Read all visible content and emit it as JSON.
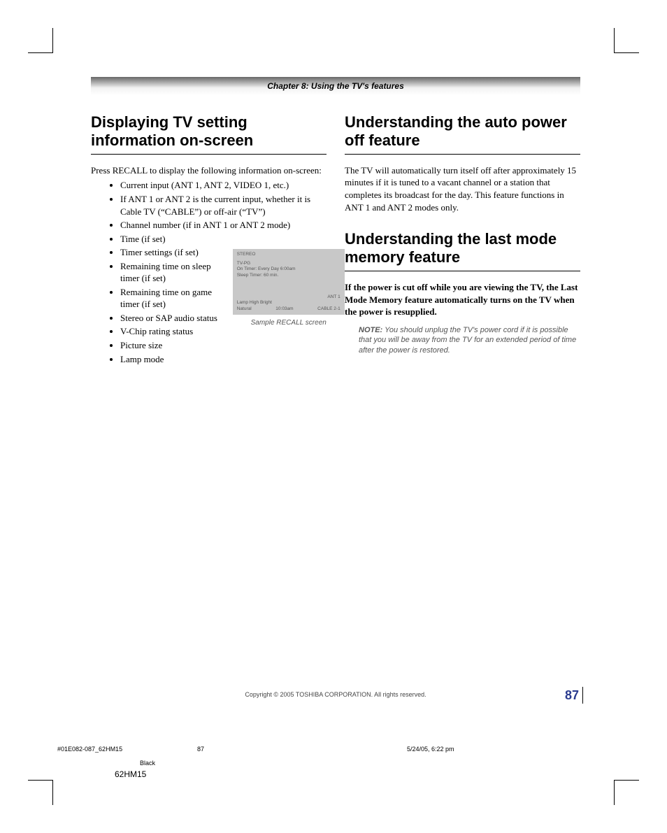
{
  "chapter": "Chapter 8: Using the TV's features",
  "left": {
    "title": "Displaying TV setting information on-screen",
    "intro": "Press RECALL to display the following information on-screen:",
    "items": [
      "Current input (ANT 1, ANT 2, VIDEO 1, etc.)",
      "If ANT 1 or ANT 2 is the current input, whether it is Cable TV (“CABLE”) or off-air (“TV”)",
      "Channel number (if in ANT 1 or ANT 2 mode)",
      "Time (if set)",
      "Timer settings (if set)",
      "Remaining time on sleep timer (if set)",
      "Remaining time on game timer (if set)",
      "Stereo or SAP audio status",
      "V-Chip rating status",
      "Picture size",
      "Lamp mode"
    ],
    "figure": {
      "caption": "Sample RECALL screen",
      "stereo": "STEREO",
      "rating": "TV-PG",
      "on_timer": "On Timer: Every Day 6:00am",
      "sleep_timer": "Sleep Timer: 60 min.",
      "ant": "ANT 1",
      "lamp": "Lamp High Bright",
      "pic": "Natural",
      "time": "10:03am",
      "cable": "CABLE 2-1"
    }
  },
  "right": {
    "section1": {
      "title": "Understanding the auto power off feature",
      "body": "The TV will automatically turn itself off after approximately 15 minutes if it is tuned to a vacant channel or a station that completes its broadcast for the day. This feature functions in ANT 1 and ANT 2 modes only."
    },
    "section2": {
      "title": "Understanding the last mode memory feature",
      "bold": "If the power is cut off while you are viewing the TV, the Last Mode Memory feature automatically turns on the TV when the power is resupplied.",
      "note_label": "NOTE:",
      "note_body": " You should unplug the TV's power cord if it is possible that you will be away from the TV for an extended period of time after the power is restored."
    }
  },
  "footer": {
    "copyright": "Copyright © 2005 TOSHIBA CORPORATION. All rights reserved.",
    "page_number": "87",
    "job_file": "#01E082-087_62HM15",
    "job_page": "87",
    "job_date": "5/24/05, 6:22 pm",
    "black": "Black",
    "model": "62HM15"
  }
}
